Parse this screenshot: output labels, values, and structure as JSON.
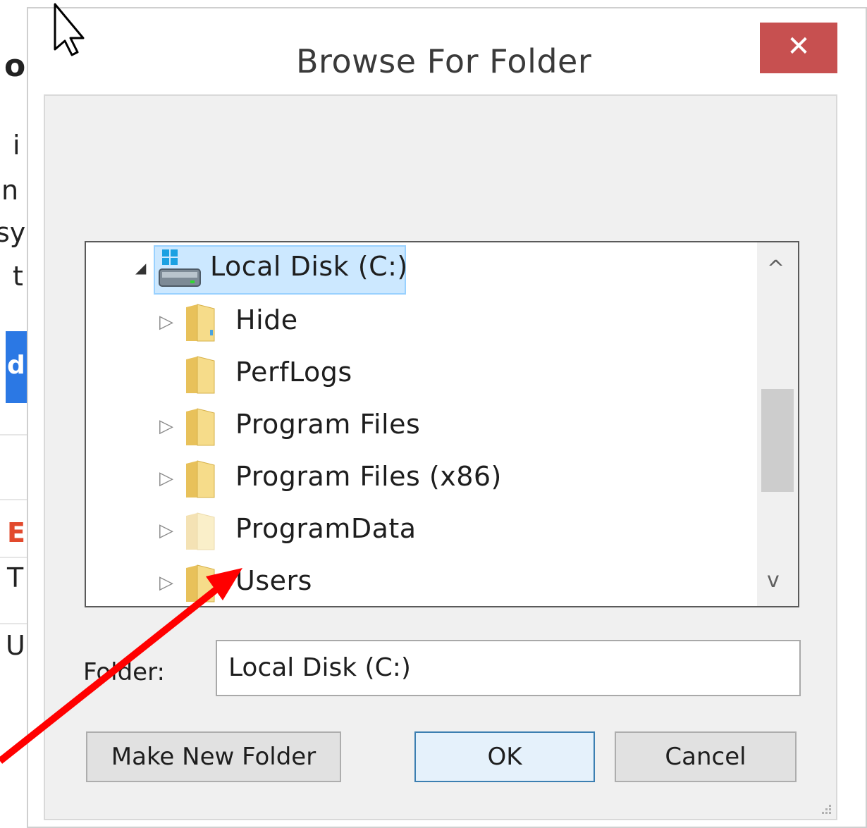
{
  "background": {
    "fragments": [
      "o",
      "i",
      "n",
      "sy",
      "t",
      "d",
      "E",
      "T",
      "U"
    ]
  },
  "dialog": {
    "title": "Browse For Folder",
    "close_label": "✕",
    "tree": {
      "items": [
        {
          "label": "Local Disk (C:)",
          "expander": "◢",
          "selected": true,
          "icon": "drive-icon"
        },
        {
          "label": "Hide",
          "expander": "▷",
          "icon": "folder-icon"
        },
        {
          "label": "PerfLogs",
          "expander": "",
          "icon": "folder-icon"
        },
        {
          "label": "Program Files",
          "expander": "▷",
          "icon": "folder-icon"
        },
        {
          "label": "Program Files (x86)",
          "expander": "▷",
          "icon": "folder-icon"
        },
        {
          "label": "ProgramData",
          "expander": "▷",
          "icon": "folder-icon-faded"
        },
        {
          "label": "Users",
          "expander": "▷",
          "icon": "folder-icon"
        }
      ],
      "scroll_up": "^",
      "scroll_down": "v"
    },
    "folder_label": "Folder:",
    "folder_value": "Local Disk (C:)",
    "buttons": {
      "make_new_folder": "Make New Folder",
      "ok": "OK",
      "cancel": "Cancel"
    }
  },
  "colors": {
    "close": "#c75050",
    "selection": "#cce8ff",
    "arrow": "#ff0000"
  }
}
